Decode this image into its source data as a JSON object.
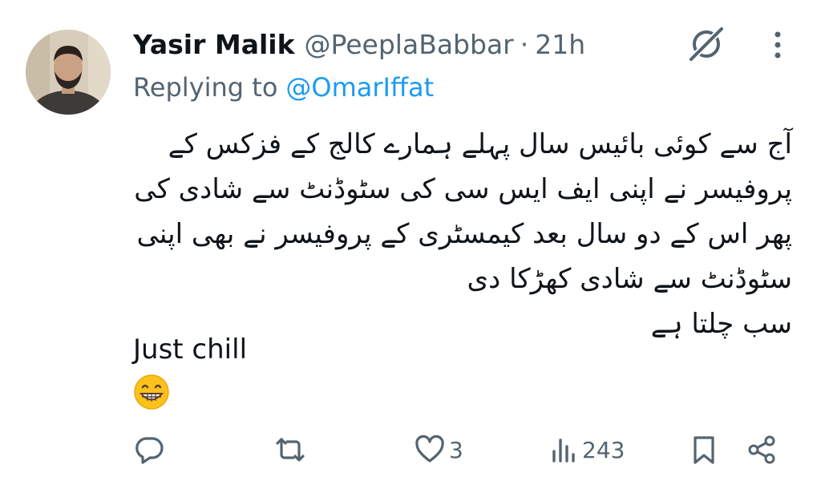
{
  "tweet": {
    "author_name": "Yasir Malik",
    "author_handle": "@PeeplaBabbar",
    "separator": "·",
    "time": "21h",
    "replying_prefix": "Replying to",
    "replying_handle": "@OmarIffat",
    "urdu_lines": [
      "آج سے کوئی بائیس سال پہلے ہمارے کالج کے فزکس کے",
      "پروفیسر نے اپنی ایف ایس سی کی سٹوڈنٹ سے شادی کی",
      "پھر اس کے دو سال بعد کیمسٹری کے پروفیسر نے بھی اپنی",
      "سٹوڈنٹ سے شادی کھڑکا دی",
      "سب چلتا ہے"
    ],
    "english_text": "Just chill",
    "emoji": "grinning-face-with-smiling-eyes"
  },
  "actions": {
    "reply_icon": "reply-icon",
    "retweet_icon": "retweet-icon",
    "like_icon": "heart-icon",
    "like_count": "3",
    "views_icon": "views-icon",
    "views_count": "243",
    "bookmark_icon": "bookmark-icon",
    "share_icon": "share-icon"
  },
  "colors": {
    "text": "#0f1419",
    "secondary": "#536471",
    "link": "#1d9bf0"
  }
}
